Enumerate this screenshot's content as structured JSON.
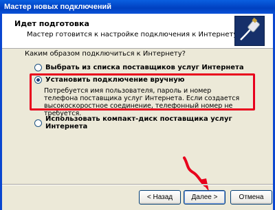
{
  "window": {
    "title": "Мастер новых подключений"
  },
  "header": {
    "title": "Идет подготовка",
    "subtitle": "Мастер готовится к настройке подключения к Интернету."
  },
  "question": "Каким образом подключиться к Интернету?",
  "options": [
    {
      "label": "Выбрать из списка поставщиков услуг Интернета",
      "selected": false
    },
    {
      "label": "Установить подключение вручную",
      "selected": true,
      "description": "Потребуется имя пользователя, пароль и  номер телефона поставщика услуг Интернета. Если создается высокоскоростное соединение, телефонный номер не требуется."
    },
    {
      "label": "Использовать компакт-диск поставщика услуг Интернета",
      "selected": false
    }
  ],
  "buttons": {
    "back": "< Назад",
    "next": "Далее >",
    "cancel": "Отмена"
  },
  "colors": {
    "annotation": "#e8001c",
    "titlebar": "#0a52d8",
    "wizard_icon_bg": "#16306a"
  },
  "icons": {
    "header_icon": "network-connection-icon",
    "annotation_arrow": "red-arrow-icon"
  }
}
